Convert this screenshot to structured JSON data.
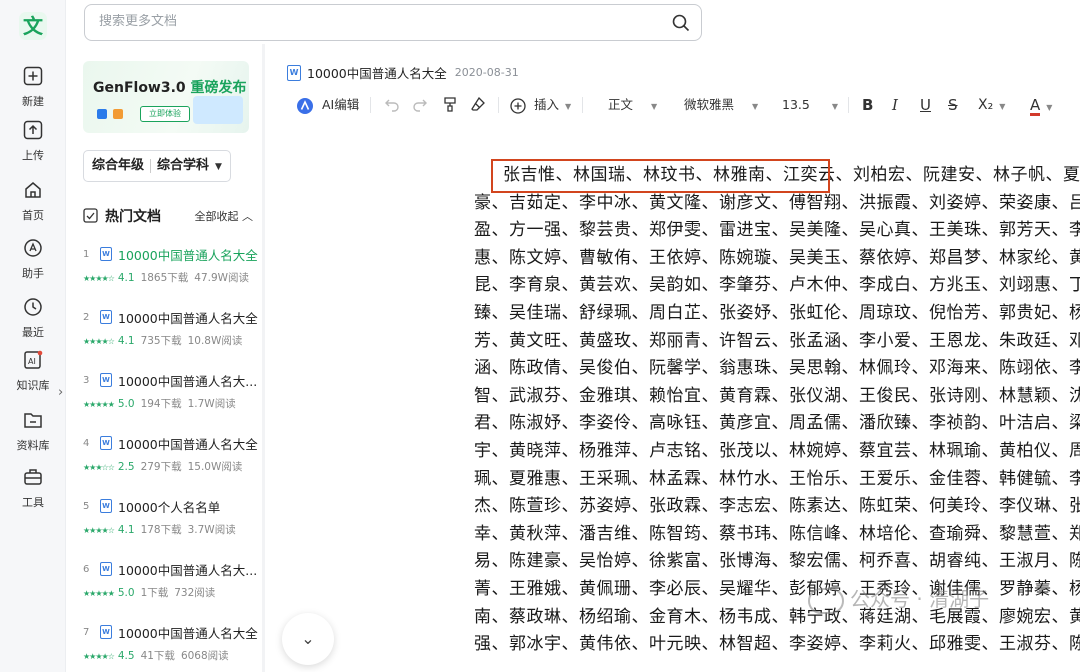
{
  "rail": {
    "logo": "文",
    "items": [
      {
        "label": "新建",
        "icon": "plus-square-icon"
      },
      {
        "label": "上传",
        "icon": "upload-icon"
      },
      {
        "label": "首页",
        "icon": "home-icon"
      },
      {
        "label": "助手",
        "icon": "assistant-icon"
      },
      {
        "label": "最近",
        "icon": "clock-icon"
      },
      {
        "label": "知识库",
        "icon": "ai-knowledge-icon"
      },
      {
        "label": "资料库",
        "icon": "folder-icon"
      },
      {
        "label": "工具",
        "icon": "toolbox-icon"
      }
    ],
    "collapse_glyph": "›"
  },
  "search": {
    "placeholder": "搜索更多文档"
  },
  "banner": {
    "title": "GenFlow3.0",
    "highlight": " 重磅发布",
    "button": "立即体验"
  },
  "filter": {
    "grade": "综合年级",
    "subject": "综合学科"
  },
  "hot_docs": {
    "title": "热门文档",
    "collapse_label": "全部收起",
    "items": [
      {
        "num": "1",
        "name": "10000中国普通人名大全",
        "stars": "★★★★☆",
        "score": "4.1",
        "downloads": "1865下载",
        "reads": "47.9W阅读"
      },
      {
        "num": "2",
        "name": "10000中国普通人名大全",
        "stars": "★★★★☆",
        "score": "4.1",
        "downloads": "735下载",
        "reads": "10.8W阅读"
      },
      {
        "num": "3",
        "name": "10000中国普通人名大...",
        "stars": "★★★★★",
        "score": "5.0",
        "downloads": "194下载",
        "reads": "1.7W阅读"
      },
      {
        "num": "4",
        "name": "10000中国普通人名大全",
        "stars": "★★★☆☆",
        "score": "2.5",
        "downloads": "279下载",
        "reads": "15.0W阅读"
      },
      {
        "num": "5",
        "name": "10000个人名名单",
        "stars": "★★★★☆",
        "score": "4.1",
        "downloads": "178下载",
        "reads": "3.7W阅读"
      },
      {
        "num": "6",
        "name": "10000中国普通人名大...",
        "stars": "★★★★★",
        "score": "5.0",
        "downloads": "1下载",
        "reads": "732阅读"
      },
      {
        "num": "7",
        "name": "10000中国普通人名大全",
        "stars": "★★★★☆",
        "score": "4.5",
        "downloads": "41下载",
        "reads": "6068阅读"
      }
    ]
  },
  "document": {
    "title": "10000中国普通人名大全",
    "date": "2020-08-31"
  },
  "toolbar": {
    "ai_edit": "AI编辑",
    "insert": "插入",
    "style": "正文",
    "font": "微软雅黑",
    "size": "13.5",
    "subscript": "X₂"
  },
  "content": {
    "lines": [
      "张吉惟、林国瑞、林玟书、林雅南、江奕云、刘柏宏、阮建安、林子帆、夏志",
      "豪、吉茹定、李中冰、黄文隆、谢彦文、傅智翔、洪振霞、刘姿婷、荣姿康、吕致",
      "盈、方一强、黎芸贵、郑伊雯、雷进宝、吴美隆、吴心真、王美珠、郭芳天、李雅",
      "惠、陈文婷、曹敏侑、王依婷、陈婉璇、吴美玉、蔡依婷、郑昌梦、林家纶、黄丽",
      "昆、李育泉、黄芸欢、吴韵如、李肇芬、卢木仲、李成白、方兆玉、刘翊惠、丁汉",
      "臻、吴佳瑞、舒绿珮、周白芷、张姿妤、张虹伦、周琼玟、倪怡芳、郭贵妃、杨佩",
      "芳、黄文旺、黄盛玫、郑丽青、许智云、张孟涵、李小爱、王恩龙、朱政廷、邓诗",
      "涵、陈政倩、吴俊伯、阮馨学、翁惠珠、吴思翰、林佩玲、邓海来、陈翊依、李建",
      "智、武淑芬、金雅琪、赖怡宜、黄育霖、张仪湖、王俊民、张诗刚、林慧颖、沈俊",
      "君、陈淑妤、李姿伶、高咏钰、黄彦宜、周孟儒、潘欣臻、李祯韵、叶洁启、梁哲",
      "宇、黄晓萍、杨雅萍、卢志铭、张茂以、林婉婷、蔡宜芸、林珮瑜、黄柏仪、周逸",
      "珮、夏雅惠、王采珮、林孟霖、林竹水、王怡乐、王爱乐、金佳蓉、韩健毓、李士",
      "杰、陈萱珍、苏姿婷、张政霖、李志宏、陈素达、陈虹荣、何美玲、李仪琳、张俞",
      "幸、黄秋萍、潘吉维、陈智筠、蔡书玮、陈信峰、林培伦、查瑜舜、黎慧萱、郑士",
      "易、陈建豪、吴怡婷、徐紫富、张博海、黎宏儒、柯乔喜、胡睿纯、王淑月、陈百",
      "菁、王雅娥、黄佩珊、李必辰、吴耀华、彭郁婷、王秀玲、谢佳儒、罗静蓁、杨舒",
      "南、蔡政琳、杨绍瑜、金育木、杨韦成、韩宁政、蒋廷湖、毛展霞、廖婉宏、黄怡",
      "强、郭冰宇、黄伟依、叶元映、林智超、李姿婷、李莉火、邱雅雯、王淑芬、陈技"
    ]
  },
  "watermark": "公众号 · 清湖子",
  "scroll_down_glyph": "⌄"
}
